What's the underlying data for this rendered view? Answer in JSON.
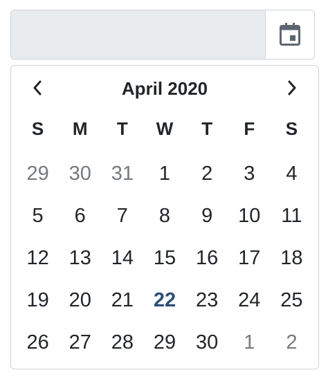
{
  "input": {
    "value": "",
    "placeholder": ""
  },
  "icons": {
    "calendar": "calendar-icon",
    "prev": "chevron-left-icon",
    "next": "chevron-right-icon"
  },
  "colors": {
    "accent": "#2c4f72",
    "muted": "#75797d",
    "input_bg": "#e9ecef",
    "border": "#ced4da"
  },
  "calendar": {
    "title": "April 2020",
    "weekdays": [
      "S",
      "M",
      "T",
      "W",
      "T",
      "F",
      "S"
    ],
    "weeks": [
      [
        {
          "d": "29",
          "m": true
        },
        {
          "d": "30",
          "m": true
        },
        {
          "d": "31",
          "m": true
        },
        {
          "d": "1"
        },
        {
          "d": "2"
        },
        {
          "d": "3"
        },
        {
          "d": "4"
        }
      ],
      [
        {
          "d": "5"
        },
        {
          "d": "6"
        },
        {
          "d": "7"
        },
        {
          "d": "8"
        },
        {
          "d": "9"
        },
        {
          "d": "10"
        },
        {
          "d": "11"
        }
      ],
      [
        {
          "d": "12"
        },
        {
          "d": "13"
        },
        {
          "d": "14"
        },
        {
          "d": "15"
        },
        {
          "d": "16"
        },
        {
          "d": "17"
        },
        {
          "d": "18"
        }
      ],
      [
        {
          "d": "19"
        },
        {
          "d": "20"
        },
        {
          "d": "21"
        },
        {
          "d": "22",
          "c": true
        },
        {
          "d": "23"
        },
        {
          "d": "24"
        },
        {
          "d": "25"
        }
      ],
      [
        {
          "d": "26"
        },
        {
          "d": "27"
        },
        {
          "d": "28"
        },
        {
          "d": "29"
        },
        {
          "d": "30"
        },
        {
          "d": "1",
          "m": true
        },
        {
          "d": "2",
          "m": true
        }
      ]
    ]
  }
}
